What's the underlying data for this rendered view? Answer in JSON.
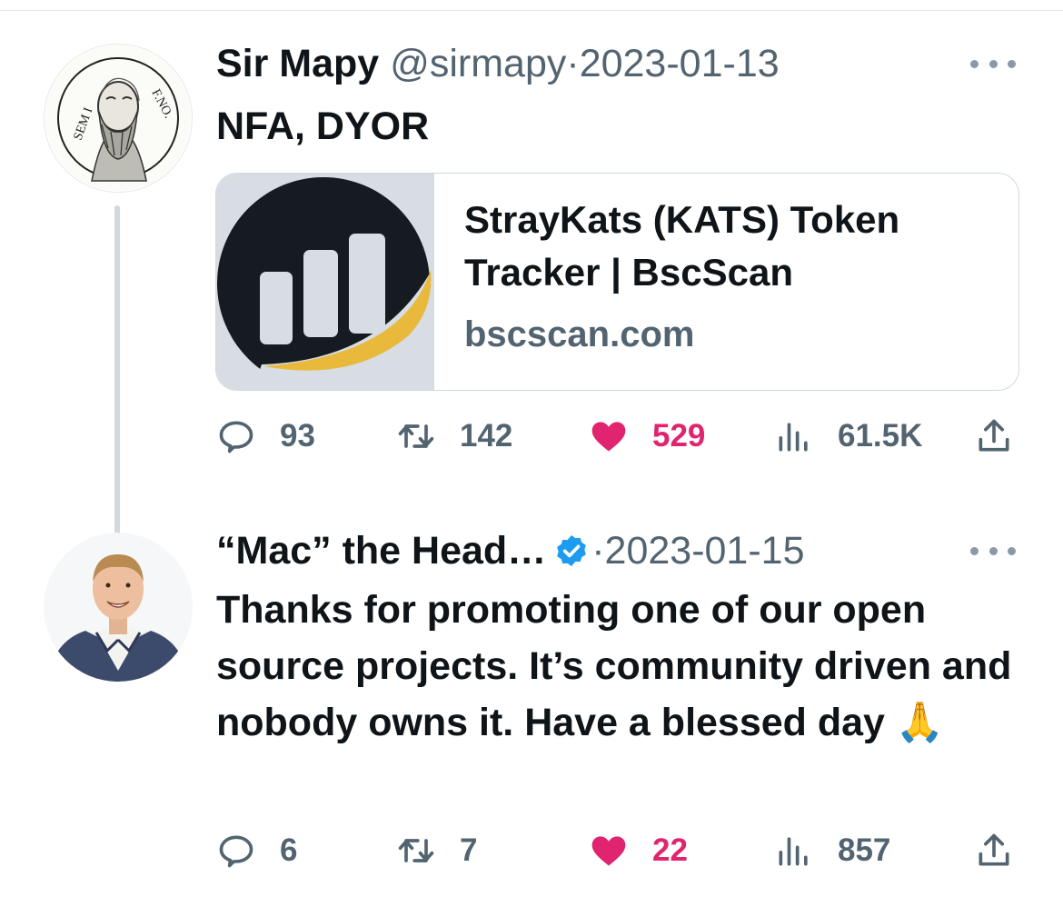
{
  "tweets": [
    {
      "display_name": "Sir Mapy",
      "handle": "@sirmapy",
      "separator": "·",
      "date": "2023-01-13",
      "text": "NFA, DYOR",
      "avatar_inscriptions": [
        "SEM I",
        "F.NO."
      ],
      "card": {
        "title": "StrayKats (KATS) Token Tracker | BscScan",
        "domain": "bscscan.com"
      },
      "stats": {
        "replies": "93",
        "retweets": "142",
        "likes": "529",
        "views": "61.5K"
      }
    },
    {
      "display_name": "“Mac” the Head…",
      "verified": true,
      "separator": "·",
      "date": "2023-01-15",
      "text": "Thanks for promoting one of our open source projects. It’s community driven and nobody owns it. Have a blessed day 🙏",
      "stats": {
        "replies": "6",
        "retweets": "7",
        "likes": "22",
        "views": "857"
      }
    }
  ],
  "colors": {
    "text_primary": "#0f1419",
    "text_secondary": "#536471",
    "like_pink": "#e0246f",
    "verified_blue": "#1d9bf0",
    "bscscan_dark": "#161b22",
    "bscscan_gold": "#e8b93b",
    "thread_line": "#cfd9de"
  },
  "icons": [
    "reply-icon",
    "retweet-icon",
    "heart-icon",
    "views-icon",
    "share-icon",
    "more-icon",
    "verified-badge-icon",
    "bscscan-logo"
  ]
}
